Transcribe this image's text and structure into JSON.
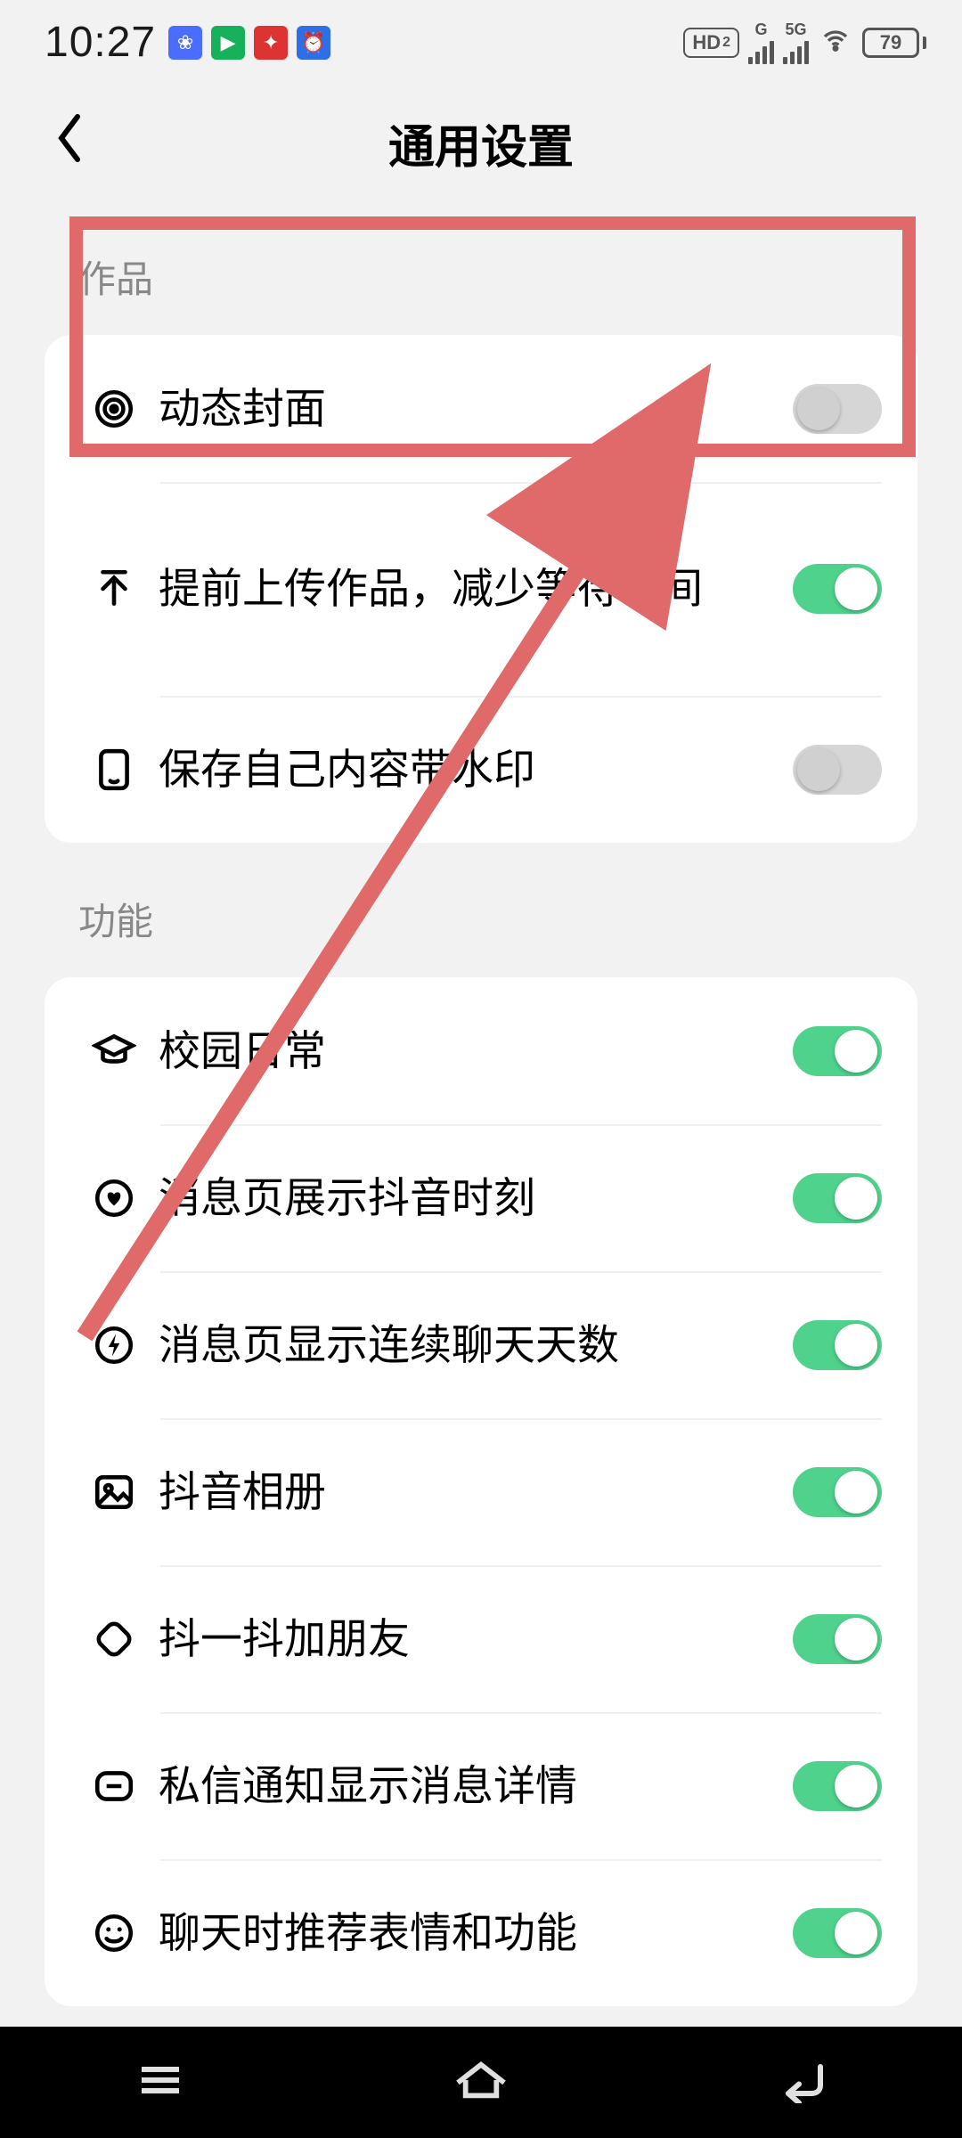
{
  "status": {
    "time": "10:27",
    "hd_badge": "HD",
    "hd_sub": "2",
    "signal1_label": "G",
    "signal2_label": "5G",
    "battery_pct": "79"
  },
  "header": {
    "title": "通用设置"
  },
  "annotation": {
    "target_row": "dynamic-cover"
  },
  "sections": [
    {
      "key": "works",
      "title": "作品",
      "rows": [
        {
          "key": "dynamic-cover",
          "icon": "target-icon",
          "label": "动态封面",
          "on": false
        },
        {
          "key": "pre-upload",
          "icon": "upload-icon",
          "label": "提前上传作品，减少等待时间",
          "on": true,
          "tall": true
        },
        {
          "key": "watermark",
          "icon": "phone-icon",
          "label": "保存自己内容带水印",
          "on": false
        }
      ]
    },
    {
      "key": "features",
      "title": "功能",
      "rows": [
        {
          "key": "campus",
          "icon": "grad-icon",
          "label": "校园日常",
          "on": true
        },
        {
          "key": "moments",
          "icon": "heart-icon",
          "label": "消息页展示抖音时刻",
          "on": true
        },
        {
          "key": "streak",
          "icon": "flash-icon",
          "label": "消息页显示连续聊天天数",
          "on": true
        },
        {
          "key": "album",
          "icon": "image-icon",
          "label": "抖音相册",
          "on": true
        },
        {
          "key": "shake",
          "icon": "rotate-icon",
          "label": "抖一抖加朋友",
          "on": true
        },
        {
          "key": "dm-detail",
          "icon": "msg-icon",
          "label": "私信通知显示消息详情",
          "on": true
        },
        {
          "key": "emoji-rec",
          "icon": "smile-icon",
          "label": "聊天时推荐表情和功能",
          "on": true
        }
      ]
    }
  ]
}
